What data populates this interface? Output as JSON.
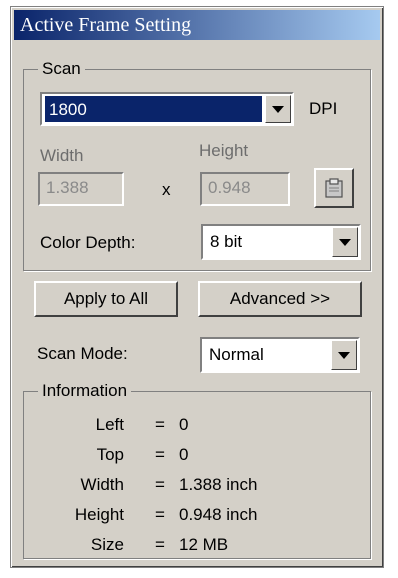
{
  "window": {
    "title": "Active Frame Setting"
  },
  "scan": {
    "legend": "Scan",
    "resolution": {
      "value": "1800",
      "unit": "DPI"
    },
    "width": {
      "label": "Width",
      "value": "1.388"
    },
    "height": {
      "label": "Height",
      "value": "0.948"
    },
    "times": "x",
    "color_depth": {
      "label": "Color Depth:",
      "value": "8 bit"
    }
  },
  "buttons": {
    "apply_all": "Apply to All",
    "advanced": "Advanced >>"
  },
  "scan_mode": {
    "label": "Scan Mode:",
    "value": "Normal"
  },
  "information": {
    "legend": "Information",
    "rows": [
      {
        "key": "Left",
        "eq": "=",
        "value": "0"
      },
      {
        "key": "Top",
        "eq": "=",
        "value": "0"
      },
      {
        "key": "Width",
        "eq": "=",
        "value": "1.388 inch"
      },
      {
        "key": "Height",
        "eq": "=",
        "value": "0.948 inch"
      },
      {
        "key": "Size",
        "eq": "=",
        "value": "12 MB"
      }
    ]
  },
  "icons": {
    "lock_ratio": "clipboard-icon",
    "dropdown": "chevron-down-icon"
  }
}
